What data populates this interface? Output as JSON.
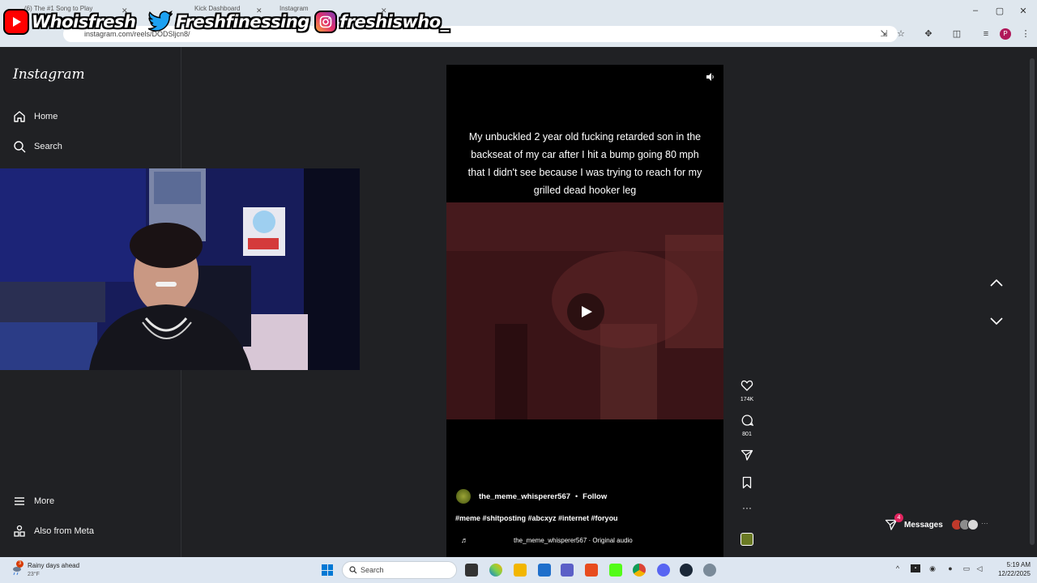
{
  "browser": {
    "tabs": [
      {
        "label": "(6) The #1 Song to Play"
      },
      {
        "label": "Kick Dashboard"
      },
      {
        "label": "Instagram"
      }
    ],
    "url": "instagram.com/reels/DODSljcn8/",
    "profile_initial": "P"
  },
  "overlay": {
    "youtube": "Whoisfresh",
    "twitter": "Freshfinessing",
    "instagram": "freshiswho_"
  },
  "sidebar": {
    "logo": "Instagram",
    "items": [
      {
        "label": "Home",
        "icon": "home-icon"
      },
      {
        "label": "Search",
        "icon": "search-icon"
      },
      {
        "label": "More",
        "icon": "menu-icon"
      },
      {
        "label": "Also from Meta",
        "icon": "meta-icon"
      }
    ]
  },
  "reel": {
    "caption_text": "My unbuckled 2 year old fucking retarded son in the backseat of my car after I hit a bump going 80 mph that I didn't see because I was trying to reach for my grilled dead hooker leg",
    "author": "the_meme_whisperer567",
    "separator": "•",
    "follow_label": "Follow",
    "hashtags": "#meme #shitposting #abcxyz #internet #foryou",
    "audio": "the_meme_whisperer567 · Original audio"
  },
  "actions": {
    "likes": "174K",
    "comments": "801"
  },
  "messages": {
    "label": "Messages",
    "badge": "4"
  },
  "taskbar": {
    "weather_title": "Rainy days ahead",
    "weather_temp": "23°F",
    "weather_badge": "3",
    "search_label": "Search",
    "time": "5:19 AM",
    "date": "12/22/2025"
  },
  "colors": {
    "page_bg": "#202124",
    "reel_bg": "#000000",
    "badge": "#e0245e",
    "youtube": "#ff0000",
    "twitter": "#1da1f2"
  }
}
